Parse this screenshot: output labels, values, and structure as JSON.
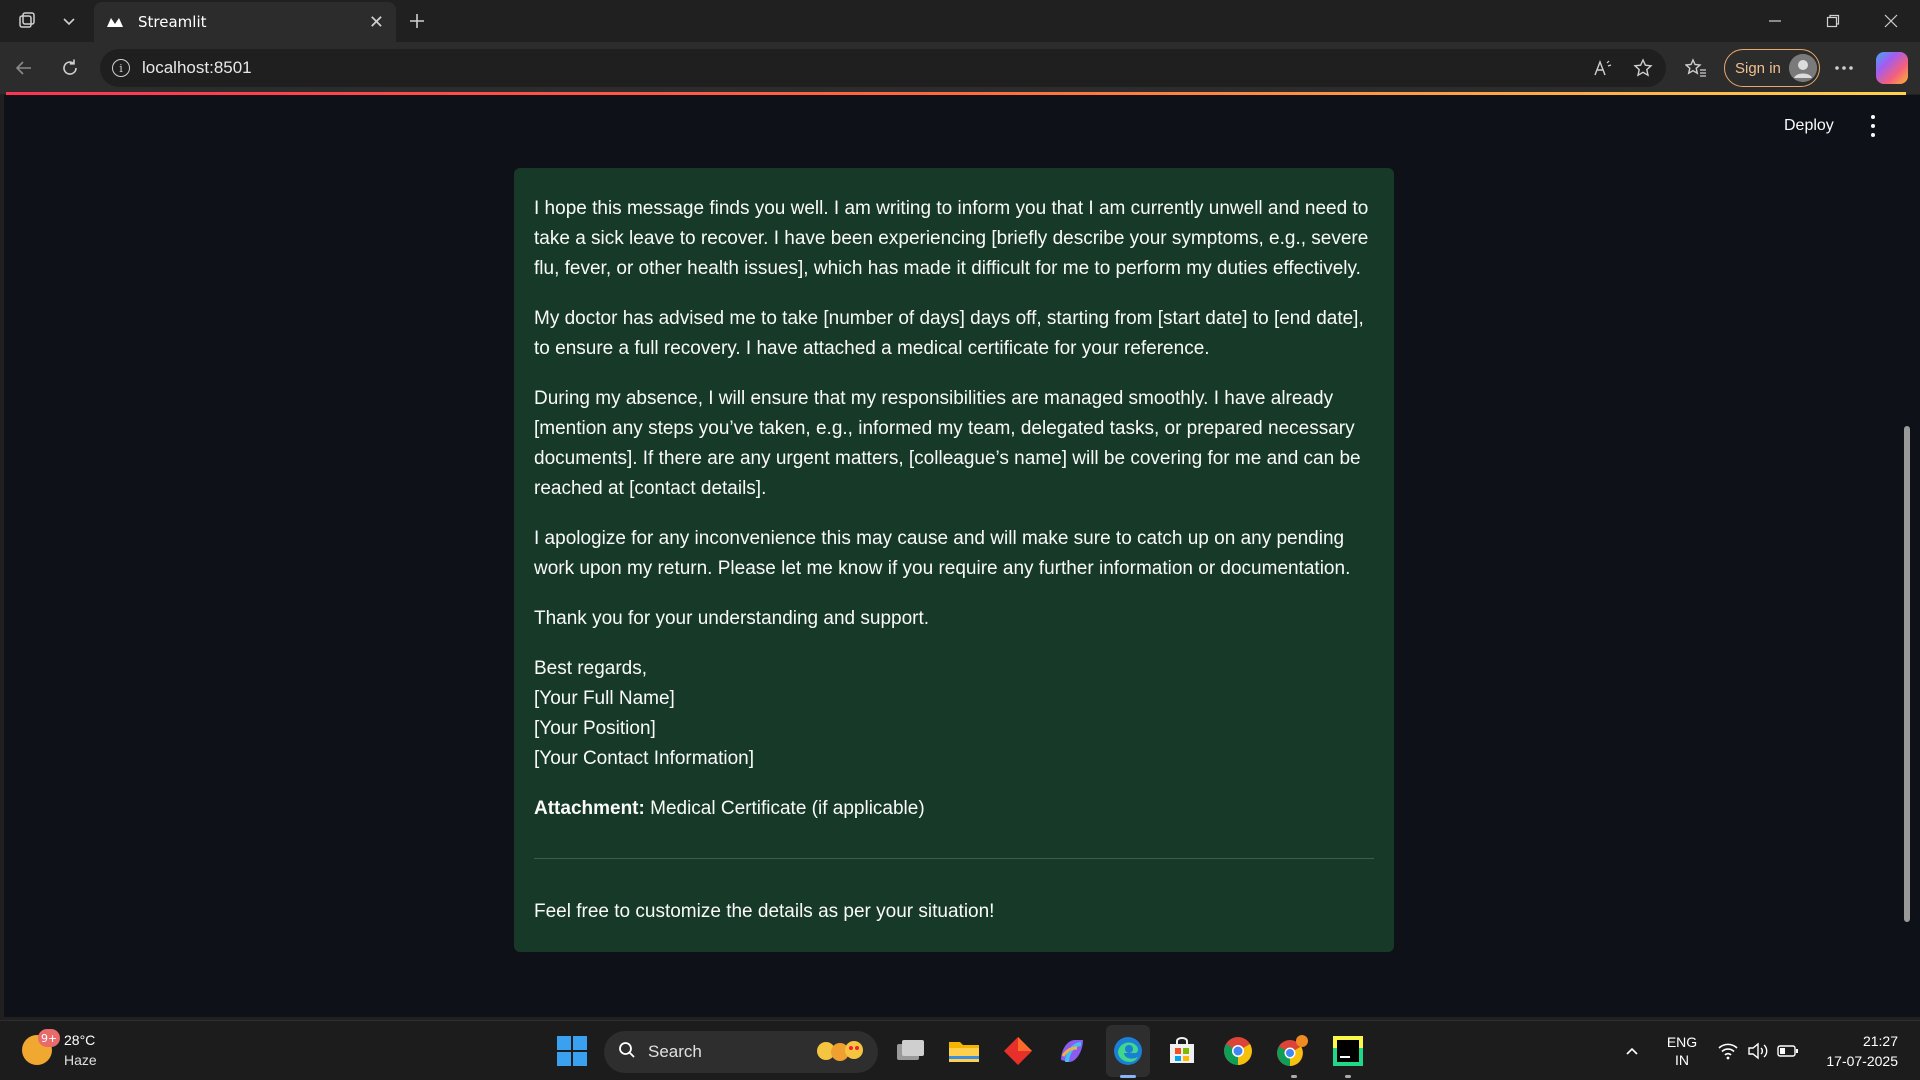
{
  "browser": {
    "tab_title": "Streamlit",
    "address": "localhost:8501",
    "signin_label": "Sign in",
    "icons": [
      "workspaces-icon",
      "tab-list-icon",
      "streamlit-favicon",
      "close-icon",
      "new-tab-icon",
      "minimize-icon",
      "restore-icon",
      "window-close-icon",
      "back-icon",
      "refresh-icon",
      "info-icon",
      "read-aloud-icon",
      "favorite-star-icon",
      "favorites-icon",
      "more-icon",
      "copilot-icon"
    ]
  },
  "app": {
    "deploy_label": "Deploy",
    "letter": {
      "p1": "I hope this message finds you well. I am writing to inform you that I am currently unwell and need to take a sick leave to recover. I have been experiencing [briefly describe your symptoms, e.g., severe flu, fever, or other health issues], which has made it difficult for me to perform my duties effectively.",
      "p2": "My doctor has advised me to take [number of days] days off, starting from [start date] to [end date], to ensure a full recovery. I have attached a medical certificate for your reference.",
      "p3": "During my absence, I will ensure that my responsibilities are managed smoothly. I have already [mention any steps you’ve taken, e.g., informed my team, delegated tasks, or prepared necessary documents]. If there are any urgent matters, [colleague’s name] will be covering for me and can be reached at [contact details].",
      "p4": "I apologize for any inconvenience this may cause and will make sure to catch up on any pending work upon my return. Please let me know if you require any further information or documentation.",
      "p5": "Thank you for your understanding and support.",
      "closing": "Best regards,",
      "sig_name": "[Your Full Name]",
      "sig_position": "[Your Position]",
      "sig_contact": "[Your Contact Information]",
      "attachment_label": "Attachment:",
      "attachment_value": " Medical Certificate (if applicable)",
      "footer_note": "Feel free to customize the details as per your situation!"
    }
  },
  "taskbar": {
    "weather_badge": "9+",
    "temperature": "28°C",
    "condition": "Haze",
    "search_label": "Search",
    "lang_line1": "ENG",
    "lang_line2": "IN",
    "time": "21:27",
    "date": "17-07-2025"
  },
  "colors": {
    "page_bg": "#0e1117",
    "card_bg": "#173928",
    "signin_border": "#e8a86a"
  }
}
